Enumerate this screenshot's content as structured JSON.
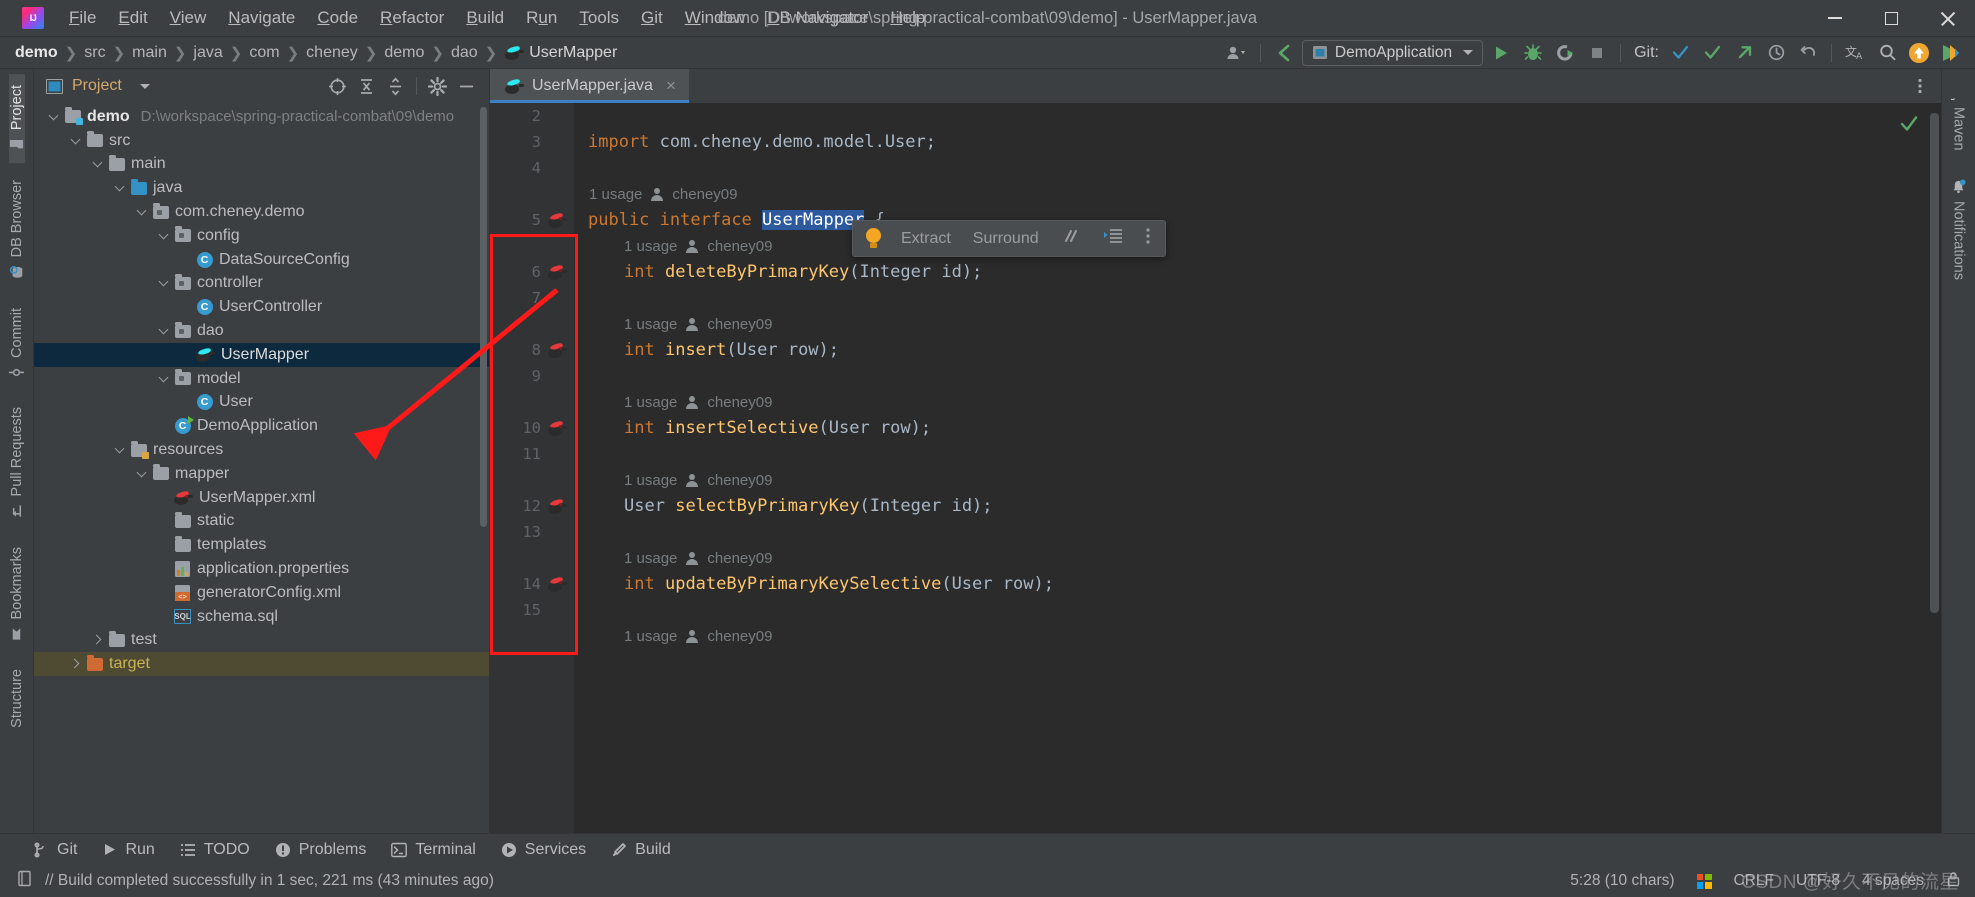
{
  "window": {
    "title": "demo [D:\\workspace\\spring-practical-combat\\09\\demo] - UserMapper.java",
    "minimize": "minimize",
    "maximize": "maximize",
    "close": "close"
  },
  "menu": [
    {
      "label": "File",
      "mnemonic": "F"
    },
    {
      "label": "Edit",
      "mnemonic": "E"
    },
    {
      "label": "View",
      "mnemonic": "V"
    },
    {
      "label": "Navigate",
      "mnemonic": "N"
    },
    {
      "label": "Code",
      "mnemonic": "C"
    },
    {
      "label": "Refactor",
      "mnemonic": "R"
    },
    {
      "label": "Build",
      "mnemonic": "B"
    },
    {
      "label": "Run",
      "mnemonic": "u"
    },
    {
      "label": "Tools",
      "mnemonic": "T"
    },
    {
      "label": "Git",
      "mnemonic": "G"
    },
    {
      "label": "Window",
      "mnemonic": "W"
    },
    {
      "label": "DB Navigator",
      "mnemonic": "D"
    },
    {
      "label": "Help",
      "mnemonic": "H"
    }
  ],
  "breadcrumbs": [
    "demo",
    "src",
    "main",
    "java",
    "com",
    "cheney",
    "demo",
    "dao",
    "UserMapper"
  ],
  "toolbar": {
    "run_config": "DemoApplication",
    "git_label": "Git:",
    "icons": [
      "user-settings-icon",
      "back-icon",
      "run-icon",
      "debug-icon",
      "run-coverage-icon",
      "stop-icon",
      "update-project-icon",
      "commit-icon",
      "push-icon",
      "history-icon",
      "rollback-icon",
      "translate-icon",
      "search-everywhere-icon",
      "update-icon",
      "plugin-icon"
    ]
  },
  "left_tool_strip": [
    {
      "label": "Project",
      "icon": "folder-icon",
      "active": true
    },
    {
      "label": "DB Browser",
      "icon": "database-search-icon",
      "active": false
    },
    {
      "label": "Commit",
      "icon": "commit-icon",
      "active": false
    },
    {
      "label": "Pull Requests",
      "icon": "pull-request-icon",
      "active": false
    },
    {
      "label": "Bookmarks",
      "icon": "bookmark-icon",
      "active": false
    },
    {
      "label": "Structure",
      "icon": "structure-icon",
      "active": false
    }
  ],
  "right_tool_strip": [
    {
      "label": "Maven",
      "icon": "maven-icon"
    },
    {
      "label": "Notifications",
      "icon": "bell-icon",
      "badge": true
    }
  ],
  "project_panel": {
    "title": "Project",
    "actions": [
      "select-opened-file-icon",
      "expand-all-icon",
      "collapse-all-icon",
      "settings-gear-icon",
      "hide-icon"
    ],
    "tree": [
      {
        "label": "demo",
        "sub": "D:\\workspace\\spring-practical-combat\\09\\demo",
        "depth": 0,
        "arrow": "down",
        "icon": "module-folder-icon",
        "bold": true
      },
      {
        "label": "src",
        "depth": 1,
        "arrow": "down",
        "icon": "folder-icon"
      },
      {
        "label": "main",
        "depth": 2,
        "arrow": "down",
        "icon": "folder-icon"
      },
      {
        "label": "java",
        "depth": 3,
        "arrow": "down",
        "icon": "source-folder-icon"
      },
      {
        "label": "com.cheney.demo",
        "depth": 4,
        "arrow": "down",
        "icon": "package-icon"
      },
      {
        "label": "config",
        "depth": 5,
        "arrow": "down",
        "icon": "package-icon"
      },
      {
        "label": "DataSourceConfig",
        "depth": 6,
        "arrow": "none",
        "icon": "class-icon"
      },
      {
        "label": "controller",
        "depth": 5,
        "arrow": "down",
        "icon": "package-icon"
      },
      {
        "label": "UserController",
        "depth": 6,
        "arrow": "none",
        "icon": "class-icon"
      },
      {
        "label": "dao",
        "depth": 5,
        "arrow": "down",
        "icon": "package-icon"
      },
      {
        "label": "UserMapper",
        "depth": 6,
        "arrow": "none",
        "icon": "mybatis-mapper-icon",
        "selected": true
      },
      {
        "label": "model",
        "depth": 5,
        "arrow": "down",
        "icon": "package-icon"
      },
      {
        "label": "User",
        "depth": 6,
        "arrow": "none",
        "icon": "class-icon"
      },
      {
        "label": "DemoApplication",
        "depth": 5,
        "arrow": "none",
        "icon": "runnable-class-icon"
      },
      {
        "label": "resources",
        "depth": 3,
        "arrow": "down",
        "icon": "resources-folder-icon"
      },
      {
        "label": "mapper",
        "depth": 4,
        "arrow": "down",
        "icon": "folder-icon"
      },
      {
        "label": "UserMapper.xml",
        "depth": 5,
        "arrow": "none",
        "icon": "mybatis-xml-icon"
      },
      {
        "label": "static",
        "depth": 4,
        "arrow": "none",
        "icon": "folder-icon"
      },
      {
        "label": "templates",
        "depth": 4,
        "arrow": "none",
        "icon": "folder-icon"
      },
      {
        "label": "application.properties",
        "depth": 4,
        "arrow": "none",
        "icon": "properties-icon"
      },
      {
        "label": "generatorConfig.xml",
        "depth": 4,
        "arrow": "none",
        "icon": "xml-icon"
      },
      {
        "label": "schema.sql",
        "depth": 4,
        "arrow": "none",
        "icon": "sql-icon"
      },
      {
        "label": "test",
        "depth": 2,
        "arrow": "right",
        "icon": "folder-icon"
      },
      {
        "label": "target",
        "depth": 1,
        "arrow": "right",
        "icon": "excluded-folder-icon",
        "highlight": true
      }
    ]
  },
  "editor": {
    "tab": {
      "label": "UserMapper.java",
      "icon": "mybatis-mapper-icon",
      "close": "×"
    },
    "action_bar": {
      "bulb": "intention-bulb-icon",
      "extract": "Extract",
      "surround": "Surround",
      "comment": "comment-icon",
      "indent": "indent-icon",
      "more": "more-icon"
    },
    "lines": [
      {
        "num": "2",
        "bird": false,
        "type": "blank",
        "text": ""
      },
      {
        "num": "3",
        "bird": false,
        "type": "code",
        "parts": [
          {
            "t": "import",
            "c": "kw"
          },
          {
            "t": " com.cheney.demo.model.User",
            "c": "typ"
          },
          {
            "t": ";",
            "c": "punc"
          }
        ]
      },
      {
        "num": "4",
        "bird": false,
        "type": "blank",
        "text": ""
      },
      {
        "num": "",
        "bird": false,
        "type": "hint",
        "usage": "1 usage",
        "author": "cheney09"
      },
      {
        "num": "5",
        "bird": true,
        "type": "code",
        "parts": [
          {
            "t": "public",
            "c": "kw"
          },
          {
            "t": " ",
            "c": "punc"
          },
          {
            "t": "interface",
            "c": "kw"
          },
          {
            "t": " ",
            "c": "punc"
          },
          {
            "t": "UserMapper",
            "c": "sel"
          },
          {
            "t": " {",
            "c": "punc"
          }
        ]
      },
      {
        "num": "",
        "bird": false,
        "type": "hint",
        "usage": "1 usage",
        "author": "cheney09",
        "indent": true
      },
      {
        "num": "6",
        "bird": true,
        "type": "code",
        "indent": true,
        "parts": [
          {
            "t": "int",
            "c": "kw"
          },
          {
            "t": " ",
            "c": "punc"
          },
          {
            "t": "deleteByPrimaryKey",
            "c": "fn"
          },
          {
            "t": "(",
            "c": "punc"
          },
          {
            "t": "Integer",
            "c": "typ"
          },
          {
            "t": " id);",
            "c": "punc"
          }
        ]
      },
      {
        "num": "7",
        "bird": false,
        "type": "blank",
        "text": ""
      },
      {
        "num": "",
        "bird": false,
        "type": "hint",
        "usage": "1 usage",
        "author": "cheney09",
        "indent": true
      },
      {
        "num": "8",
        "bird": true,
        "type": "code",
        "indent": true,
        "parts": [
          {
            "t": "int",
            "c": "kw"
          },
          {
            "t": " ",
            "c": "punc"
          },
          {
            "t": "insert",
            "c": "fn"
          },
          {
            "t": "(",
            "c": "punc"
          },
          {
            "t": "User",
            "c": "typ"
          },
          {
            "t": " row);",
            "c": "punc"
          }
        ]
      },
      {
        "num": "9",
        "bird": false,
        "type": "blank",
        "text": ""
      },
      {
        "num": "",
        "bird": false,
        "type": "hint",
        "usage": "1 usage",
        "author": "cheney09",
        "indent": true
      },
      {
        "num": "10",
        "bird": true,
        "type": "code",
        "indent": true,
        "parts": [
          {
            "t": "int",
            "c": "kw"
          },
          {
            "t": " ",
            "c": "punc"
          },
          {
            "t": "insertSelective",
            "c": "fn"
          },
          {
            "t": "(",
            "c": "punc"
          },
          {
            "t": "User",
            "c": "typ"
          },
          {
            "t": " row);",
            "c": "punc"
          }
        ]
      },
      {
        "num": "11",
        "bird": false,
        "type": "blank",
        "text": ""
      },
      {
        "num": "",
        "bird": false,
        "type": "hint",
        "usage": "1 usage",
        "author": "cheney09",
        "indent": true
      },
      {
        "num": "12",
        "bird": true,
        "type": "code",
        "indent": true,
        "parts": [
          {
            "t": "User",
            "c": "typ"
          },
          {
            "t": " ",
            "c": "punc"
          },
          {
            "t": "selectByPrimaryKey",
            "c": "fn"
          },
          {
            "t": "(",
            "c": "punc"
          },
          {
            "t": "Integer",
            "c": "typ"
          },
          {
            "t": " id);",
            "c": "punc"
          }
        ]
      },
      {
        "num": "13",
        "bird": false,
        "type": "blank",
        "text": ""
      },
      {
        "num": "",
        "bird": false,
        "type": "hint",
        "usage": "1 usage",
        "author": "cheney09",
        "indent": true
      },
      {
        "num": "14",
        "bird": true,
        "type": "code",
        "indent": true,
        "parts": [
          {
            "t": "int",
            "c": "kw"
          },
          {
            "t": " ",
            "c": "punc"
          },
          {
            "t": "updateByPrimaryKeySelective",
            "c": "fn"
          },
          {
            "t": "(",
            "c": "punc"
          },
          {
            "t": "User",
            "c": "typ"
          },
          {
            "t": " row);",
            "c": "punc"
          }
        ]
      },
      {
        "num": "15",
        "bird": false,
        "type": "blank",
        "text": ""
      },
      {
        "num": "",
        "bird": false,
        "type": "hint",
        "usage": "1 usage",
        "author": "cheney09",
        "indent": true
      }
    ]
  },
  "bottom_tools": [
    {
      "label": "Git",
      "icon": "git-branch-icon"
    },
    {
      "label": "Run",
      "icon": "run-icon"
    },
    {
      "label": "TODO",
      "icon": "todo-list-icon"
    },
    {
      "label": "Problems",
      "icon": "problems-icon"
    },
    {
      "label": "Terminal",
      "icon": "terminal-icon"
    },
    {
      "label": "Services",
      "icon": "services-icon"
    },
    {
      "label": "Build",
      "icon": "build-hammer-icon"
    }
  ],
  "status_bar": {
    "message": "// Build completed successfully in 1 sec, 221 ms (43 minutes ago)",
    "message_icon": "event-log-icon",
    "caret_position": "5:28 (10 chars)",
    "line_separator": "CRLF",
    "encoding": "UTF-8",
    "indent": "4 spaces",
    "os_icon": "windows-logo-icon",
    "lock_icon": "read-only-lock-icon",
    "watermark": "CSDN @好久不见的流星"
  },
  "colors": {
    "accent_blue": "#3d81c4",
    "selection_blue": "#0d293e",
    "keyword_orange": "#cc7832",
    "method_yellow": "#ffc66d",
    "annotation_red": "#ff1a1a",
    "panel_bg": "#3c3f41",
    "editor_bg": "#2b2b2b"
  }
}
